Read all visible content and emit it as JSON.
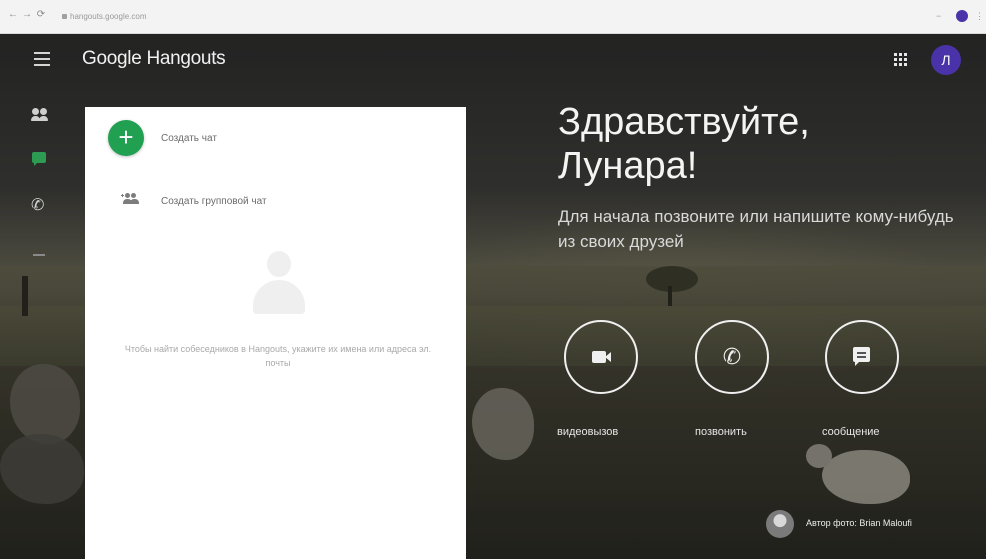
{
  "browser": {
    "url": "hangouts.google.com",
    "back_glyph": "←",
    "forward_glyph": "→",
    "reload_glyph": "⟳",
    "menu_glyph": "⋮",
    "minus_glyph": "−"
  },
  "header": {
    "title": "Google Hangouts",
    "avatar_letter": "Л"
  },
  "rail": {
    "items": [
      {
        "name": "contacts",
        "icon": "people-icon"
      },
      {
        "name": "chats",
        "icon": "chat-icon",
        "active": true
      },
      {
        "name": "calls",
        "icon": "phone-icon"
      }
    ],
    "phone_glyph": "✆"
  },
  "panel": {
    "new_chat_glyph": "+",
    "new_chat_label": "Создать чат",
    "new_group_label": "Создать групповой чат",
    "empty_text": "Чтобы найти собеседников в Hangouts, укажите их имена или адреса эл. почты"
  },
  "greeting": {
    "title_line1": "Здравствуйте,",
    "title_line2": "Лунара!",
    "subtitle": "Для начала позвоните или напишите кому-нибудь из своих друзей"
  },
  "actions": [
    {
      "icon": "video-camera-icon",
      "label": "видеовызов"
    },
    {
      "icon": "phone-icon",
      "label": "позвонить",
      "glyph": "✆"
    },
    {
      "icon": "message-icon",
      "label": "сообщение"
    }
  ],
  "credit": {
    "text": "Автор фото: Brian Maloufi"
  },
  "colors": {
    "accent_green": "#21a051",
    "avatar_purple": "#4a33a8"
  }
}
